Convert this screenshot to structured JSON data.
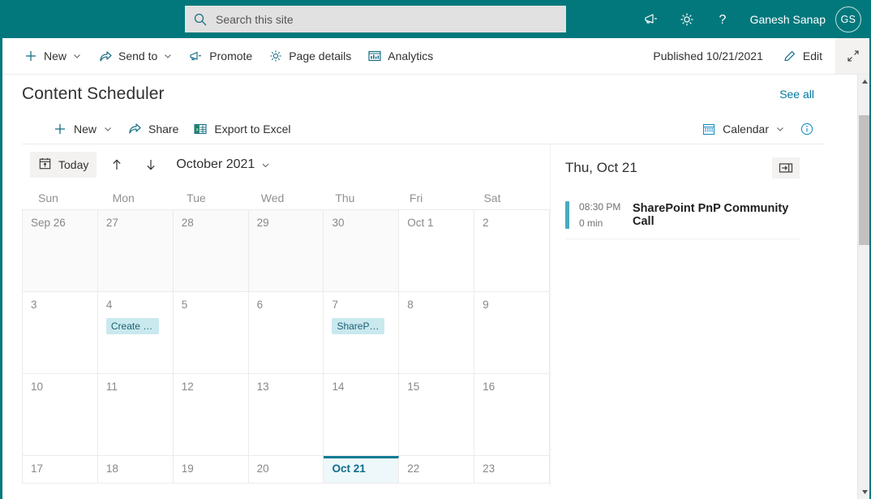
{
  "suite": {
    "search": {
      "placeholder": "Search this site",
      "value": "",
      "icon": "search-icon"
    },
    "megaphone_icon": "megaphone-icon",
    "settings_icon": "gear-icon",
    "help_icon": "help-icon",
    "user_name": "Ganesh Sanap",
    "avatar_initials": "GS",
    "background_color": "#03787c"
  },
  "command_bar": {
    "items": [
      {
        "label": "New",
        "icon": "plus-icon",
        "has_chevron": true
      },
      {
        "label": "Send to",
        "icon": "share-icon",
        "has_chevron": true
      },
      {
        "label": "Promote",
        "icon": "megaphone-icon",
        "has_chevron": false
      },
      {
        "label": "Page details",
        "icon": "gear-icon",
        "has_chevron": false
      },
      {
        "label": "Analytics",
        "icon": "analytics-icon",
        "has_chevron": false
      }
    ],
    "published_status": "Published 10/21/2021",
    "edit_label": "Edit",
    "edit_icon": "pencil-icon",
    "collapse_icon": "collapse-arrows-icon"
  },
  "webpart": {
    "title": "Content Scheduler",
    "see_all_label": "See all",
    "toolbar": {
      "items": [
        {
          "label": "New",
          "icon": "plus-icon",
          "has_chevron": true
        },
        {
          "label": "Share",
          "icon": "share-icon",
          "has_chevron": false
        },
        {
          "label": "Export to Excel",
          "icon": "excel-icon",
          "has_chevron": false
        }
      ],
      "view_label": "Calendar",
      "view_icon": "calendar-icon",
      "info_icon": "info-icon"
    }
  },
  "calendar": {
    "today_label": "Today",
    "today_icon": "calendar-today-icon",
    "prev_icon": "arrow-up-icon",
    "next_icon": "arrow-down-icon",
    "month_label": "October 2021",
    "month_chevron_icon": "chevron-down-icon",
    "day_headers": [
      "Sun",
      "Mon",
      "Tue",
      "Wed",
      "Thu",
      "Fri",
      "Sat"
    ],
    "weeks": [
      [
        {
          "label": "Sep 26",
          "current_month": false,
          "selected": false,
          "events": []
        },
        {
          "label": "27",
          "current_month": false,
          "selected": false,
          "events": []
        },
        {
          "label": "28",
          "current_month": false,
          "selected": false,
          "events": []
        },
        {
          "label": "29",
          "current_month": false,
          "selected": false,
          "events": []
        },
        {
          "label": "30",
          "current_month": false,
          "selected": false,
          "events": []
        },
        {
          "label": "Oct 1",
          "current_month": true,
          "selected": false,
          "events": []
        },
        {
          "label": "2",
          "current_month": true,
          "selected": false,
          "events": []
        }
      ],
      [
        {
          "label": "3",
          "current_month": true,
          "selected": false,
          "events": []
        },
        {
          "label": "4",
          "current_month": true,
          "selected": false,
          "events": [
            "Create a ..."
          ]
        },
        {
          "label": "5",
          "current_month": true,
          "selected": false,
          "events": []
        },
        {
          "label": "6",
          "current_month": true,
          "selected": false,
          "events": []
        },
        {
          "label": "7",
          "current_month": true,
          "selected": false,
          "events": [
            "SharePoin..."
          ]
        },
        {
          "label": "8",
          "current_month": true,
          "selected": false,
          "events": []
        },
        {
          "label": "9",
          "current_month": true,
          "selected": false,
          "events": []
        }
      ],
      [
        {
          "label": "10",
          "current_month": true,
          "selected": false,
          "events": []
        },
        {
          "label": "11",
          "current_month": true,
          "selected": false,
          "events": []
        },
        {
          "label": "12",
          "current_month": true,
          "selected": false,
          "events": []
        },
        {
          "label": "13",
          "current_month": true,
          "selected": false,
          "events": []
        },
        {
          "label": "14",
          "current_month": true,
          "selected": false,
          "events": []
        },
        {
          "label": "15",
          "current_month": true,
          "selected": false,
          "events": []
        },
        {
          "label": "16",
          "current_month": true,
          "selected": false,
          "events": []
        }
      ],
      [
        {
          "label": "17",
          "current_month": true,
          "selected": false,
          "events": []
        },
        {
          "label": "18",
          "current_month": true,
          "selected": false,
          "events": []
        },
        {
          "label": "19",
          "current_month": true,
          "selected": false,
          "events": []
        },
        {
          "label": "20",
          "current_month": true,
          "selected": false,
          "events": []
        },
        {
          "label": "Oct 21",
          "current_month": true,
          "selected": true,
          "events": []
        },
        {
          "label": "22",
          "current_month": true,
          "selected": false,
          "events": []
        },
        {
          "label": "23",
          "current_month": true,
          "selected": false,
          "events": []
        }
      ]
    ],
    "event_chip_bg": "#c9e9ef",
    "event_chip_color": "#1b5f72",
    "selected_border_color": "#0d7b94"
  },
  "day_panel": {
    "title": "Thu, Oct 21",
    "dock_icon": "dock-panel-icon",
    "events": [
      {
        "time": "08:30 PM",
        "duration": "0 min",
        "title": "SharePoint PnP Community Call",
        "bar_color": "#49a9c0"
      }
    ]
  },
  "scrollbar": {
    "up_icon": "scroll-up-icon",
    "down_icon": "scroll-down-icon"
  }
}
